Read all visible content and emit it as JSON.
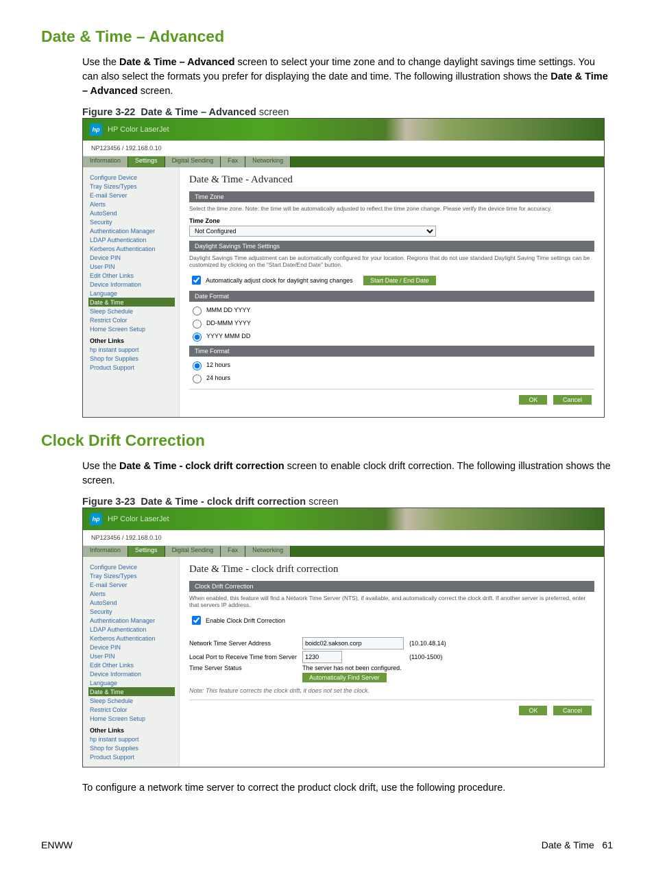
{
  "section1": {
    "heading": "Date & Time – Advanced",
    "intro_a": "Use the ",
    "intro_bold": "Date & Time – Advanced",
    "intro_b": " screen to select your time zone and to change daylight savings time settings. You can also select the formats you prefer for displaying the date and time. The following illustration shows the ",
    "intro_bold2": "Date & Time – Advanced",
    "intro_c": " screen.",
    "figlabel": "Figure 3-22",
    "figtitle_bold": "Date & Time – Advanced",
    "figtitle_tail": " screen",
    "hostline": "NP123456 / 192.168.0.10",
    "product": "HP Color LaserJet",
    "tabs": [
      "Information",
      "Settings",
      "Digital Sending",
      "Fax",
      "Networking"
    ],
    "sidebar1": [
      "Configure Device",
      "Tray Sizes/Types",
      "E-mail Server",
      "Alerts",
      "AutoSend",
      "Security",
      "Authentication Manager",
      "LDAP Authentication",
      "Kerberos Authentication",
      "Device PIN",
      "User PIN",
      "Edit Other Links",
      "Device Information",
      "Language"
    ],
    "sidebar_active": "Date & Time",
    "sidebar2": [
      "Sleep Schedule",
      "Restrict Color",
      "Home Screen Setup"
    ],
    "otherlinks_header": "Other Links",
    "otherlinks": [
      "hp instant support",
      "Shop for Supplies",
      "Product Support"
    ],
    "panel_title": "Date & Time - Advanced",
    "bar_tz": "Time Zone",
    "tz_hint": "Select the time zone. Note: the time will be automatically adjusted to reflect the time zone change. Please verify the device time for accuracy.",
    "tz_label": "Time Zone",
    "tz_value": "Not Configured",
    "bar_dst": "Daylight Savings Time Settings",
    "dst_hint": "Daylight Savings Time adjustment can be automatically configured for your location. Regions that do not use standard Daylight Saving Time settings can be customized by clicking on the \"Start Date/End Date\" button.",
    "dst_chk": "Automatically adjust clock for daylight saving changes",
    "dst_btn": "Start Date / End Date",
    "bar_df": "Date Format",
    "r1": "MMM DD YYYY",
    "r2": "DD-MMM YYYY",
    "r3": "YYYY MMM DD",
    "bar_tf": "Time Format",
    "t1": "12 hours",
    "t2": "24 hours",
    "ok": "OK",
    "cancel": "Cancel"
  },
  "section2": {
    "heading": "Clock Drift Correction",
    "intro_a": "Use the ",
    "intro_bold": "Date & Time - clock drift correction",
    "intro_b": " screen to enable clock drift correction. The following illustration shows the screen.",
    "figlabel": "Figure 3-23",
    "figtitle_bold": "Date & Time - clock drift correction",
    "figtitle_tail": " screen",
    "panel_title": "Date & Time - clock drift correction",
    "bar": "Clock Drift Correction",
    "hint": "When enabled, this feature will find a Network Time Server (NTS), if available, and automatically correct the clock drift. If another server is preferred, enter that servers IP address.",
    "chk": "Enable Clock Drift Correction",
    "row1_label": "Network Time Server Address",
    "row1_val": "boidc02.sakson.corp",
    "row1_paren": "(10.10.48.14)",
    "row2_label": "Local Port to Receive Time from Server",
    "row2_val": "1230",
    "row2_paren": "(1100-1500)",
    "row3_label": "Time Server Status",
    "row3_val": "The server has not been configured.",
    "find_btn": "Automatically Find Server",
    "note": "Note: This feature corrects the clock drift, it does not set the clock.",
    "ok": "OK",
    "cancel": "Cancel",
    "outro": "To configure a network time server to correct the product clock drift, use the following procedure."
  },
  "footer": {
    "left": "ENWW",
    "right_text": "Date & Time",
    "right_page": "61"
  }
}
